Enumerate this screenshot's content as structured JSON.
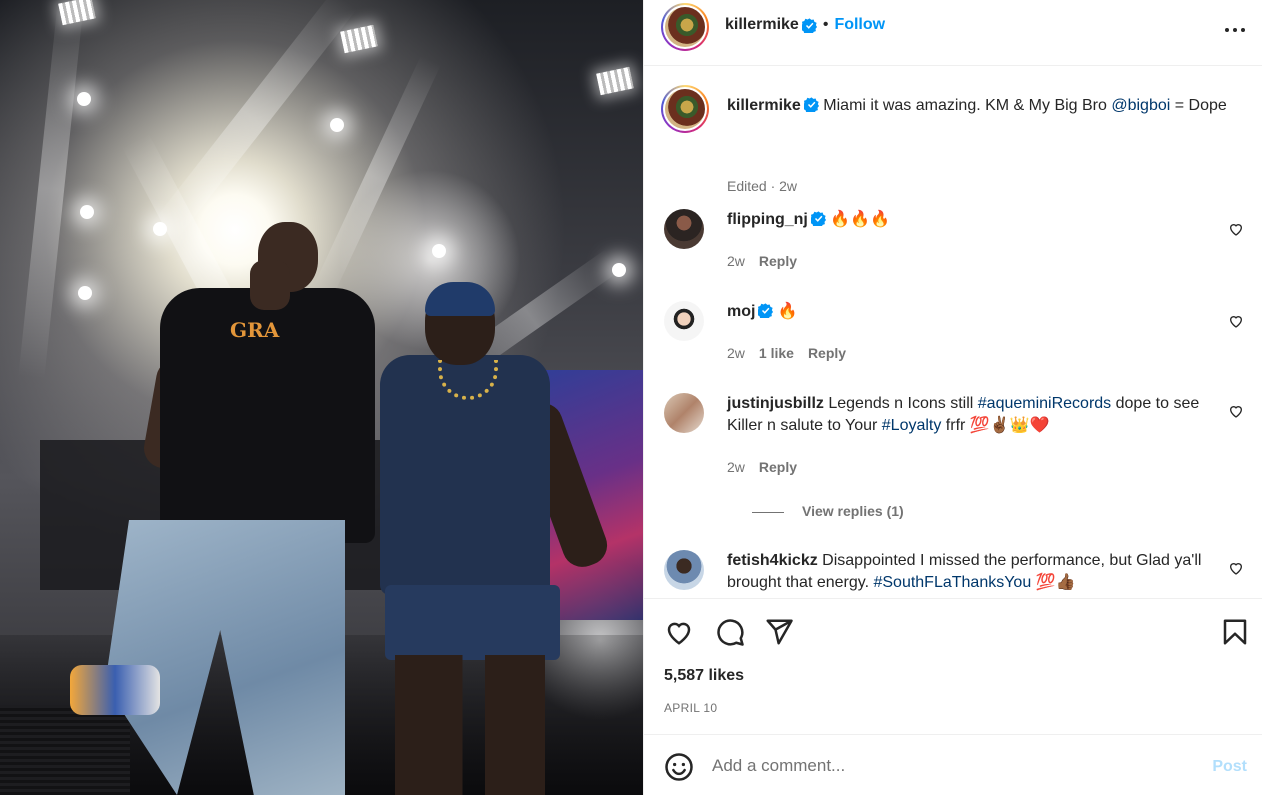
{
  "post": {
    "photo_alt": "Two performers on stage under bright spotlights",
    "photo_shirt_text": "GRA"
  },
  "header": {
    "username": "killermike",
    "separator": "•",
    "follow_label": "Follow",
    "more_icon": "more-horizontal-icon"
  },
  "caption": {
    "username": "killermike",
    "text_before": "Miami it was amazing. KM & My Big Bro ",
    "mention": "@bigboi",
    "text_after": " = Dope",
    "meta": "Edited · 2w"
  },
  "comments": [
    {
      "username": "flipping_nj",
      "verified": true,
      "text": "🔥🔥🔥",
      "time": "2w",
      "likes": "",
      "reply": "Reply"
    },
    {
      "username": "moj",
      "verified": true,
      "text": "🔥",
      "time": "2w",
      "likes": "1 like",
      "reply": "Reply"
    },
    {
      "username": "justinjusbillz",
      "verified": false,
      "text_a": "Legends n Icons still ",
      "tag_a": "#aqueminiRecords",
      "text_b": " dope to see Killer n salute to Your ",
      "tag_b": "#Loyalty",
      "text_c": " frfr 💯✌🏾👑❤️",
      "time": "2w",
      "likes": "",
      "reply": "Reply",
      "view_replies": "View replies (1)"
    },
    {
      "username": "fetish4kickz",
      "verified": false,
      "text_a": "Disappointed I missed the performance, but Glad ya'll brought that energy. ",
      "tag_a": "#SouthFLaThanksYou",
      "text_b": " 💯👍🏾"
    }
  ],
  "actions": {
    "likes": "5,587 likes",
    "date": "APRIL 10"
  },
  "comment_box": {
    "placeholder": "Add a comment...",
    "post_label": "Post"
  },
  "colors": {
    "accent": "#0095f6",
    "link": "#00376b",
    "muted": "#737373"
  }
}
